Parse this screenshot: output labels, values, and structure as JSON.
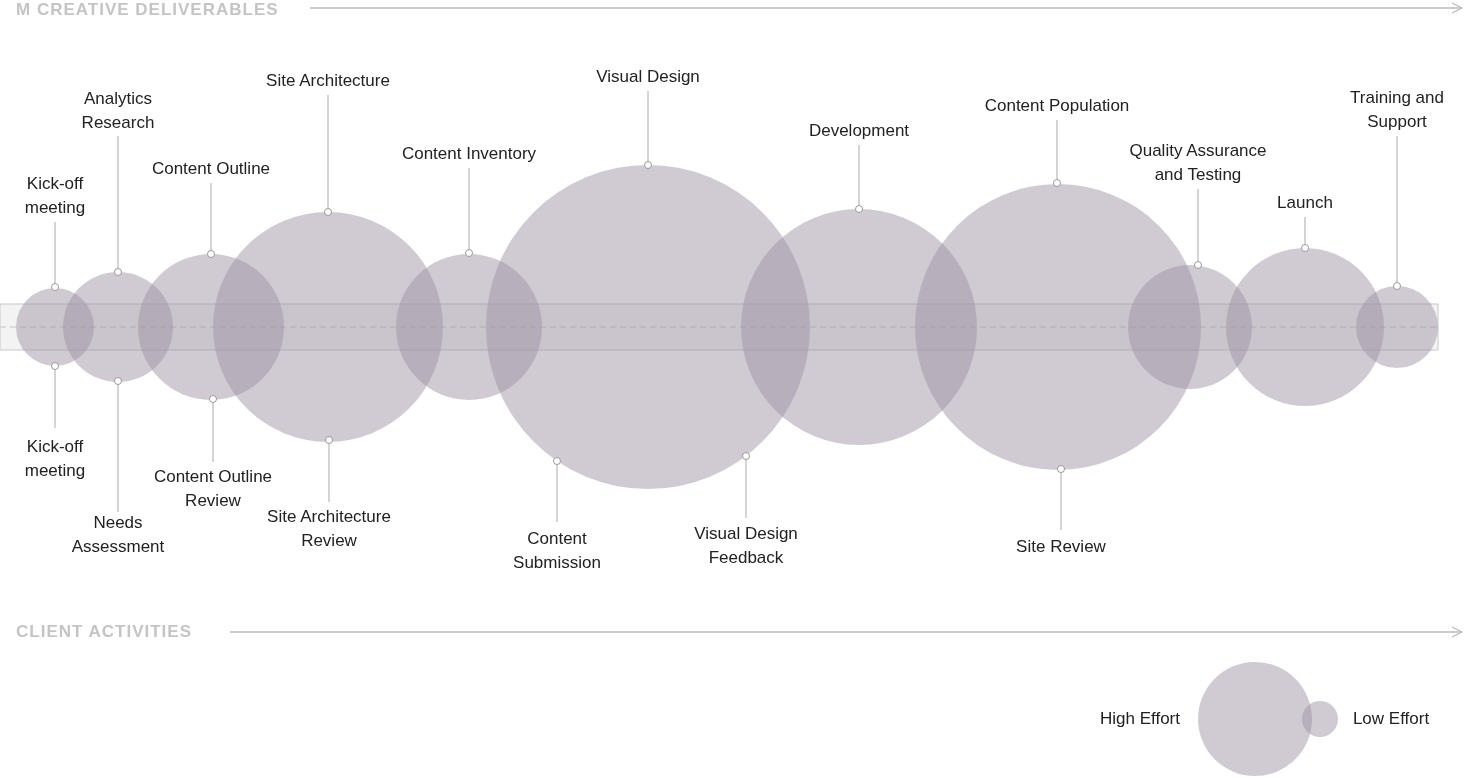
{
  "deliverables_heading": "M CREATIVE DELIVERABLES",
  "deliverables": [
    {
      "label": "Kick-off\nmeeting"
    },
    {
      "label": "Analytics\nResearch"
    },
    {
      "label": "Content Outline"
    },
    {
      "label": "Site Architecture"
    },
    {
      "label": "Content Inventory"
    },
    {
      "label": "Visual Design"
    },
    {
      "label": "Development"
    },
    {
      "label": "Content Population"
    },
    {
      "label": "Quality Assurance\nand Testing"
    },
    {
      "label": "Launch"
    },
    {
      "label": "Training and\nSupport"
    }
  ],
  "client_activities": [
    {
      "label": "Kick-off\nmeeting"
    },
    {
      "label": "Needs\nAssessment"
    },
    {
      "label": "Content Outline\nReview"
    },
    {
      "label": "Site Architecture\nReview"
    },
    {
      "label": "Content\nSubmission"
    },
    {
      "label": "Visual Design\nFeedback"
    },
    {
      "label": "Site Review"
    }
  ],
  "client_heading": "CLIENT ACTIVITIES",
  "legend": {
    "high_label": "High Effort",
    "low_label": "Low Effort"
  }
}
